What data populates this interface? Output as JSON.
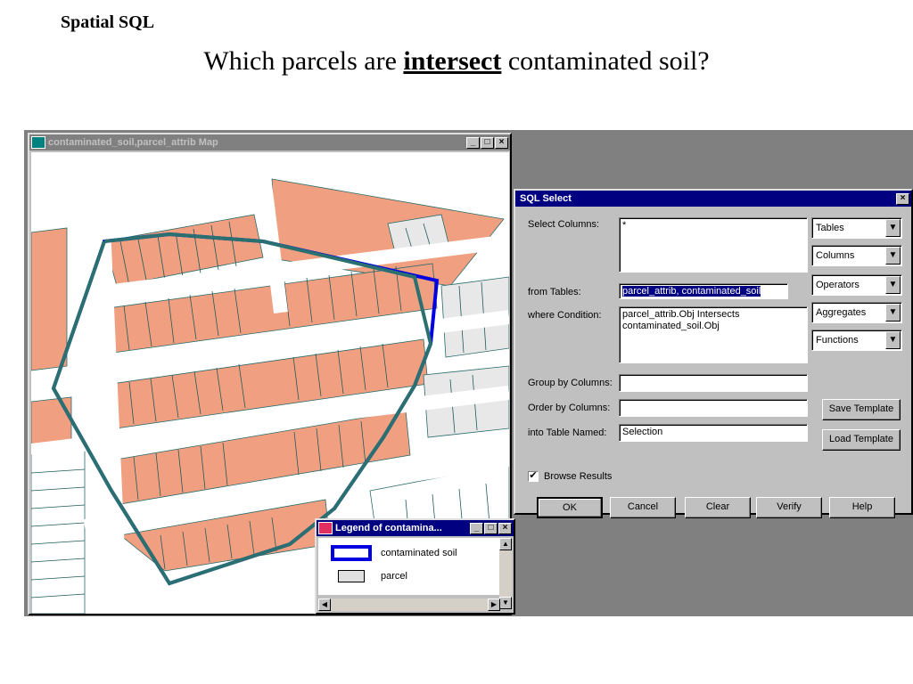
{
  "slide": {
    "small_title": "Spatial SQL",
    "title_before": "Which parcels are ",
    "title_highlight": "intersect",
    "title_after": " contaminated soil?"
  },
  "map_window": {
    "title": "contaminated_soil,parcel_attrib Map"
  },
  "sql_dialog": {
    "title": "SQL Select",
    "select_columns_label": "Select Columns:",
    "select_columns_value": "*",
    "from_tables_label": "from Tables:",
    "from_tables_value": "parcel_attrib, contaminated_soil",
    "where_label": "where Condition:",
    "where_value": "parcel_attrib.Obj Intersects contaminated_soil.Obj",
    "group_by_label": "Group by Columns:",
    "group_by_value": "",
    "order_by_label": "Order by Columns:",
    "order_by_value": "",
    "into_table_label": "into Table Named:",
    "into_table_value": "Selection",
    "browse_results_label": "Browse Results",
    "browse_results_checked": true,
    "combos": [
      "Tables",
      "Columns",
      "Operators",
      "Aggregates",
      "Functions"
    ],
    "buttons": {
      "ok": "OK",
      "cancel": "Cancel",
      "clear": "Clear",
      "verify": "Verify",
      "help": "Help",
      "save_template": "Save Template",
      "load_template": "Load Template"
    }
  },
  "legend_window": {
    "title": "Legend of contamina...",
    "items": [
      {
        "label": "contaminated soil",
        "color": "#0000e0"
      },
      {
        "label": "parcel",
        "color": "#e0e0e0"
      }
    ]
  },
  "colors": {
    "selected_parcel": "#f0a080",
    "soil_boundary": "#0000e0",
    "intersect_outline": "#2a7070",
    "titlebar_active": "#000080"
  }
}
